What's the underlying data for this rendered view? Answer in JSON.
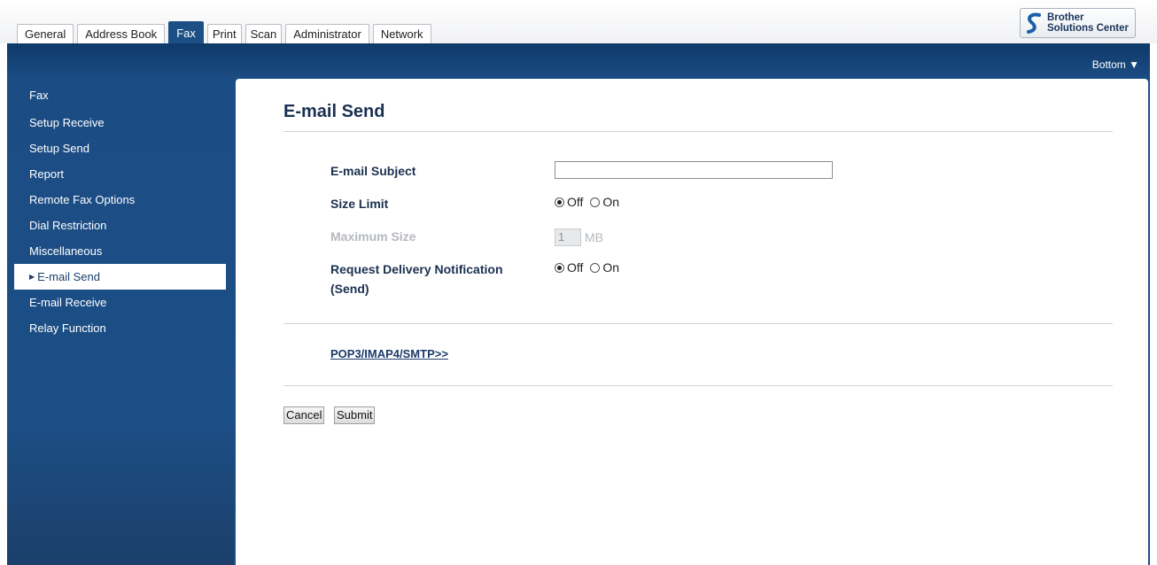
{
  "tabs": [
    {
      "label": "General"
    },
    {
      "label": "Address Book"
    },
    {
      "label": "Fax",
      "active": true
    },
    {
      "label": "Print"
    },
    {
      "label": "Scan"
    },
    {
      "label": "Administrator"
    },
    {
      "label": "Network"
    }
  ],
  "brand": {
    "line1": "Brother",
    "line2": "Solutions Center",
    "icon": "brother-s-logo-icon"
  },
  "nav": {
    "bottom_label": "Bottom ▼"
  },
  "sidebar": {
    "heading": "Fax",
    "items": [
      {
        "label": "Setup Receive"
      },
      {
        "label": "Setup Send"
      },
      {
        "label": "Report"
      },
      {
        "label": "Remote Fax Options"
      },
      {
        "label": "Dial Restriction"
      },
      {
        "label": "Miscellaneous"
      },
      {
        "label": "E-mail Send",
        "active": true
      },
      {
        "label": "E-mail Receive"
      },
      {
        "label": "Relay Function"
      }
    ]
  },
  "main": {
    "title": "E-mail Send",
    "email_subject": {
      "label": "E-mail Subject",
      "value": ""
    },
    "size_limit": {
      "label": "Size Limit",
      "off": "Off",
      "on": "On",
      "selected": "Off"
    },
    "max_size": {
      "label": "Maximum Size",
      "value": "1",
      "unit": "MB",
      "disabled": true
    },
    "delivery": {
      "label_line1": "Request Delivery Notification",
      "label_line2": "(Send)",
      "off": "Off",
      "on": "On",
      "selected": "Off"
    },
    "link": "POP3/IMAP4/SMTP>>",
    "cancel": "Cancel",
    "submit": "Submit"
  },
  "colors": {
    "accent": "#1d4f87",
    "title": "#1b3050"
  }
}
